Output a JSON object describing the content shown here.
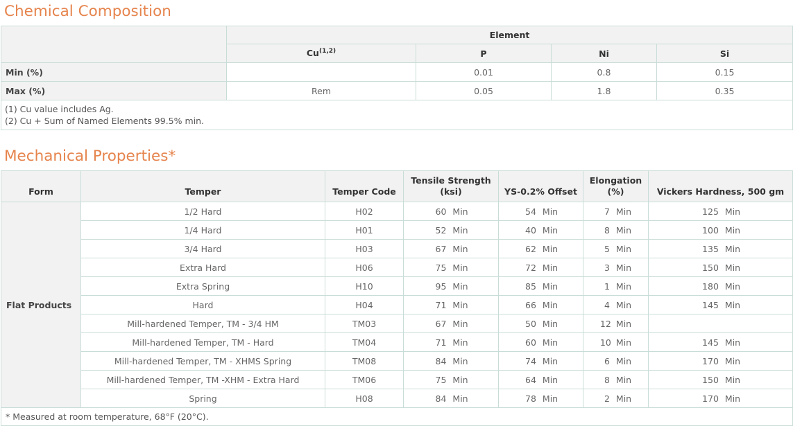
{
  "chem": {
    "title": "Chemical Composition",
    "group_header": "Element",
    "col_cu": "Cu",
    "col_cu_sup": "(1,2)",
    "col_p": "P",
    "col_ni": "Ni",
    "col_si": "Si",
    "rows": [
      {
        "label": "Min (%)",
        "cu": "",
        "p": "0.01",
        "ni": "0.8",
        "si": "0.15"
      },
      {
        "label": "Max (%)",
        "cu": "Rem",
        "p": "0.05",
        "ni": "1.8",
        "si": "0.35"
      }
    ],
    "notes": [
      "(1) Cu value includes Ag.",
      "(2) Cu + Sum of Named Elements 99.5% min."
    ]
  },
  "mech": {
    "title": "Mechanical Properties*",
    "headers": {
      "form": "Form",
      "temper": "Temper",
      "temper_code": "Temper Code",
      "tensile_1": "Tensile Strength",
      "tensile_2": "(ksi)",
      "ys": "YS-0.2% Offset",
      "elong_1": "Elongation",
      "elong_2": "(%)",
      "hardness": "Vickers Hardness, 500 gm"
    },
    "form": "Flat Products",
    "min_label": "Min",
    "rows": [
      {
        "temper": "1/2 Hard",
        "code": "H02",
        "tensile": "60",
        "ys": "54",
        "elong": "7",
        "hv": "125"
      },
      {
        "temper": "1/4 Hard",
        "code": "H01",
        "tensile": "52",
        "ys": "40",
        "elong": "8",
        "hv": "100"
      },
      {
        "temper": "3/4 Hard",
        "code": "H03",
        "tensile": "67",
        "ys": "62",
        "elong": "5",
        "hv": "135"
      },
      {
        "temper": "Extra Hard",
        "code": "H06",
        "tensile": "75",
        "ys": "72",
        "elong": "3",
        "hv": "150"
      },
      {
        "temper": "Extra Spring",
        "code": "H10",
        "tensile": "95",
        "ys": "85",
        "elong": "1",
        "hv": "180"
      },
      {
        "temper": "Hard",
        "code": "H04",
        "tensile": "71",
        "ys": "66",
        "elong": "4",
        "hv": "145"
      },
      {
        "temper": "Mill-hardened Temper, TM - 3/4 HM",
        "code": "TM03",
        "tensile": "67",
        "ys": "50",
        "elong": "12",
        "hv": ""
      },
      {
        "temper": "Mill-hardened Temper, TM - Hard",
        "code": "TM04",
        "tensile": "71",
        "ys": "60",
        "elong": "10",
        "hv": "145"
      },
      {
        "temper": "Mill-hardened Temper, TM - XHMS Spring",
        "code": "TM08",
        "tensile": "84",
        "ys": "74",
        "elong": "6",
        "hv": "170"
      },
      {
        "temper": "Mill-hardened Temper, TM -XHM - Extra Hard",
        "code": "TM06",
        "tensile": "75",
        "ys": "64",
        "elong": "8",
        "hv": "150"
      },
      {
        "temper": "Spring",
        "code": "H08",
        "tensile": "84",
        "ys": "78",
        "elong": "2",
        "hv": "170"
      }
    ],
    "footnote": "* Measured at room temperature, 68°F (20°C)."
  },
  "colors": {
    "title": "#e6844d",
    "border": "#c9ddd8",
    "header_bg": "#f2f2f2"
  }
}
